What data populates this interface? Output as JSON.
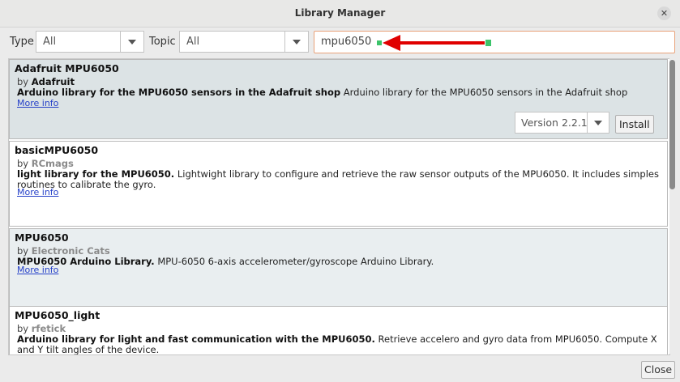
{
  "window": {
    "title": "Library Manager",
    "close_glyph": "✕"
  },
  "filters": {
    "type_label": "Type",
    "type_value": "All",
    "topic_label": "Topic",
    "topic_value": "All",
    "search_value": "mpu6050"
  },
  "libraries": [
    {
      "name": "Adafruit MPU6050",
      "by": "by",
      "author": "Adafruit",
      "summary": "Arduino library for the MPU6050 sensors in the Adafruit shop",
      "description": "Arduino library for the MPU6050 sensors in the Adafruit shop",
      "more_info": "More info",
      "version": "Version 2.2.1",
      "install": "Install"
    },
    {
      "name": "basicMPU6050",
      "by": "by",
      "author": "RCmags",
      "summary": "light library for the MPU6050.",
      "description": "Lightwight library to configure and retrieve the raw sensor outputs of the MPU6050. It includes simples routines to calibrate the gyro.",
      "more_info": "More info"
    },
    {
      "name": "MPU6050",
      "by": "by",
      "author": "Electronic Cats",
      "summary": "MPU6050 Arduino Library.",
      "description": "MPU-6050 6-axis accelerometer/gyroscope Arduino Library.",
      "more_info": "More info"
    },
    {
      "name": "MPU6050_light",
      "by": "by",
      "author": "rfetick",
      "summary": "Arduino library for light and fast communication with the MPU6050.",
      "description": "Retrieve accelero and gyro data from MPU6050. Compute X and Y tilt angles of the device."
    }
  ],
  "footer": {
    "close_label": "Close"
  },
  "colors": {
    "selected_row": "#dce3e5",
    "link": "#2540c8",
    "search_border": "#e9a27a",
    "annotation_arrow": "#e00000",
    "annotation_handle": "#3cc46a"
  }
}
